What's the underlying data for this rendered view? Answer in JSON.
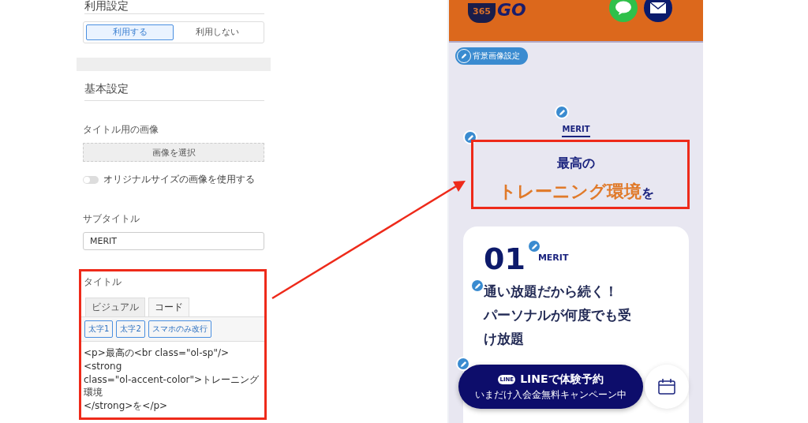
{
  "usage_settings": {
    "title": "利用設定",
    "options": [
      {
        "label": "利用する",
        "selected": true
      },
      {
        "label": "利用しない",
        "selected": false
      }
    ]
  },
  "basic_settings": {
    "title": "基本設定",
    "title_image": {
      "label": "タイトル用の画像",
      "button": "画像を選択"
    },
    "original_size_toggle": {
      "label": "オリジナルサイズの画像を使用する",
      "on": false
    },
    "subtitle": {
      "label": "サブタイトル",
      "value": "MERIT"
    },
    "title_field": {
      "label": "タイトル",
      "tabs": [
        {
          "label": "ビジュアル",
          "selected": false
        },
        {
          "label": "コード",
          "selected": true
        }
      ],
      "toolbar_buttons": [
        "太字1",
        "太字2",
        "スマホのみ改行"
      ],
      "code": "<p>最高の<br class=\"ol-sp\"/><strong\nclass=\"ol-accent-color\">トレーニング環境\n</strong>を</p>"
    }
  },
  "preview": {
    "logo": {
      "badge": "365",
      "text": "GO"
    },
    "background_button": "背景画像設定",
    "section_label": "MERIT",
    "title": {
      "line1": "最高の",
      "accent": "トレーニング環境",
      "suffix": "を"
    },
    "card": {
      "number": "01",
      "label": "MERIT",
      "heading_lines": [
        "通い放題だから続く！",
        "パーソナルが何度でも受",
        "け放題"
      ]
    },
    "line_button": {
      "icon_text": "LINE",
      "title": "LINEで体験予約",
      "subtitle": "いまだけ入会金無料キャンペーン中"
    }
  }
}
